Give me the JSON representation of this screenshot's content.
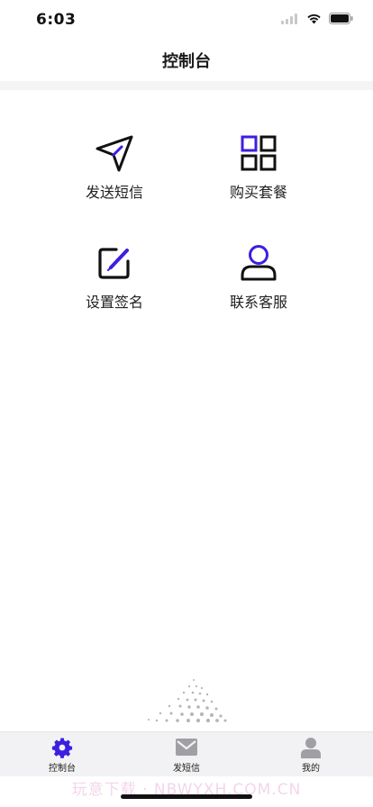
{
  "status": {
    "time": "6:03"
  },
  "nav": {
    "title": "控制台"
  },
  "grid": {
    "items": [
      {
        "label": "发送短信",
        "icon": "send-icon"
      },
      {
        "label": "购买套餐",
        "icon": "grid-icon"
      },
      {
        "label": "设置签名",
        "icon": "edit-icon"
      },
      {
        "label": "联系客服",
        "icon": "person-icon"
      }
    ]
  },
  "tabs": [
    {
      "label": "控制台",
      "icon": "gear-icon",
      "active": true
    },
    {
      "label": "发短信",
      "icon": "mail-icon",
      "active": false
    },
    {
      "label": "我的",
      "icon": "user-icon",
      "active": false
    }
  ],
  "watermark": "玩意下载 · NBWYXH.COM.CN",
  "colors": {
    "accent": "#3b1fe0",
    "tab_inactive": "#9a9a9e",
    "band": "#f4f4f5"
  }
}
